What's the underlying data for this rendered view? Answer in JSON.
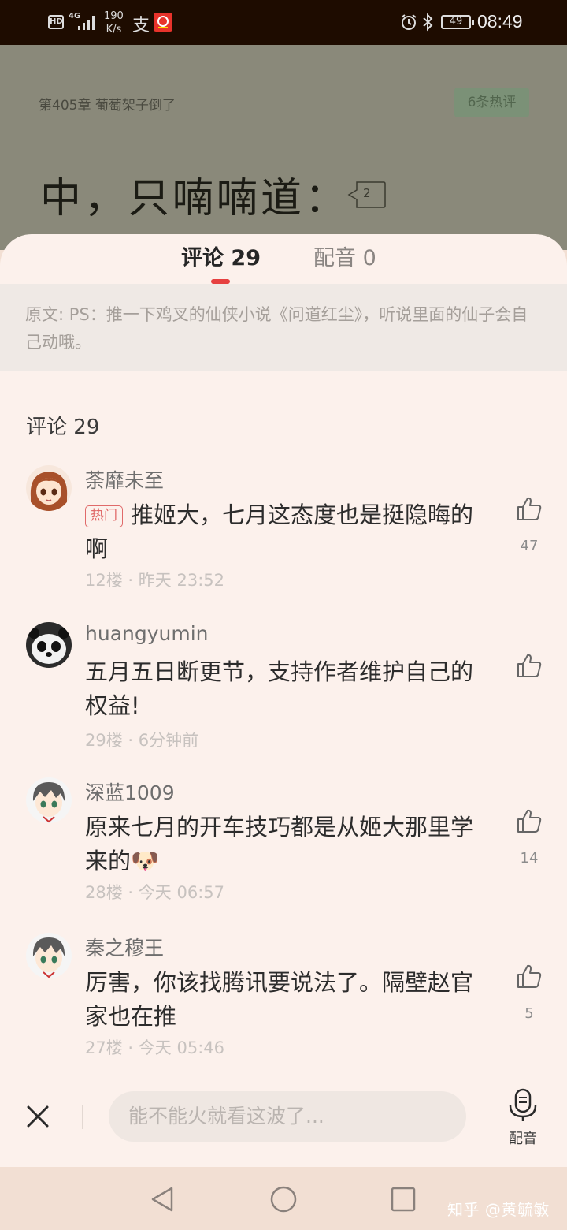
{
  "status_bar": {
    "hd": "HD",
    "network": "4G",
    "speed_value": "190",
    "speed_unit": "K/s",
    "app_icon_1": "支",
    "battery": "49",
    "time": "08:49",
    "icons": [
      "hd-icon",
      "signal-icon",
      "alipay-icon",
      "app-icon",
      "alarm-icon",
      "bluetooth-icon",
      "battery-icon"
    ]
  },
  "reader": {
    "chapter_title": "第405章 葡萄架子倒了",
    "hot_comments_badge": "6条热评",
    "text_line": "中，只喃喃道：",
    "paragraph_comment_count": "2"
  },
  "sheet": {
    "tabs": [
      {
        "label": "评论",
        "count": "29",
        "active": true
      },
      {
        "label": "配音",
        "count": "0",
        "active": false
      }
    ],
    "source_text": "原文: PS：推一下鸡叉的仙侠小说《问道红尘》，听说里面的仙子会自己动哦。",
    "section_label": "评论",
    "section_count": "29",
    "comments": [
      {
        "username": "荼靡未至",
        "tag": "热门",
        "text": "推姬大，七月这态度也是挺隐晦的啊",
        "floor": "12楼",
        "time": "昨天 23:52",
        "likes": "47",
        "avatar": "anime-girl-avatar"
      },
      {
        "username": "huangyumin",
        "tag": "",
        "text": "五月五日断更节，支持作者维护自己的权益!",
        "floor": "29楼",
        "time": "6分钟前",
        "likes": "",
        "avatar": "panda-avatar"
      },
      {
        "username": "深蓝1009",
        "tag": "",
        "text": "原来七月的开车技巧都是从姬大那里学来的",
        "emoji": "🐶",
        "floor": "28楼",
        "time": "今天 06:57",
        "likes": "14",
        "avatar": "anime-boy-avatar"
      },
      {
        "username": "秦之穆王",
        "tag": "",
        "text": "厉害，你该找腾讯要说法了。隔壁赵官家也在推",
        "floor": "27楼",
        "time": "今天 05:46",
        "likes": "5",
        "avatar": "anime-boy-avatar"
      }
    ],
    "meta_separator": "·",
    "input_placeholder": "能不能火就看这波了...",
    "dub_label": "配音"
  },
  "watermark": "知乎 @黄毓敏",
  "colors": {
    "accent_red": "#e64040",
    "sheet_bg": "#fcf1ec",
    "reader_overlay": "#8a897a"
  }
}
